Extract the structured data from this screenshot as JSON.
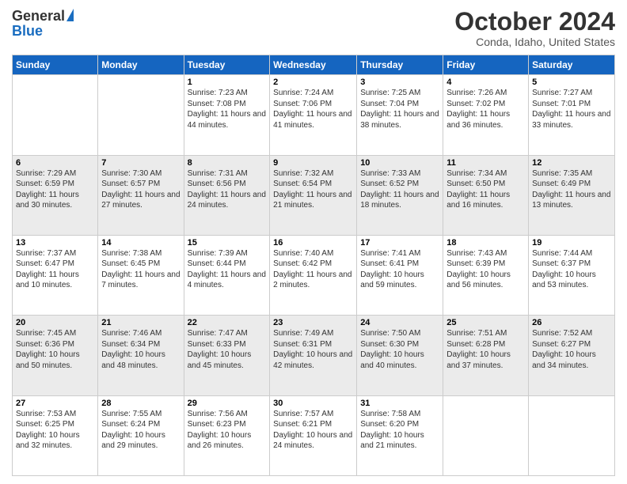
{
  "header": {
    "logo_line1": "General",
    "logo_line2": "Blue",
    "month_title": "October 2024",
    "location": "Conda, Idaho, United States"
  },
  "days_of_week": [
    "Sunday",
    "Monday",
    "Tuesday",
    "Wednesday",
    "Thursday",
    "Friday",
    "Saturday"
  ],
  "weeks": [
    [
      {
        "day": "",
        "sunrise": "",
        "sunset": "",
        "daylight": ""
      },
      {
        "day": "",
        "sunrise": "",
        "sunset": "",
        "daylight": ""
      },
      {
        "day": "1",
        "sunrise": "Sunrise: 7:23 AM",
        "sunset": "Sunset: 7:08 PM",
        "daylight": "Daylight: 11 hours and 44 minutes."
      },
      {
        "day": "2",
        "sunrise": "Sunrise: 7:24 AM",
        "sunset": "Sunset: 7:06 PM",
        "daylight": "Daylight: 11 hours and 41 minutes."
      },
      {
        "day": "3",
        "sunrise": "Sunrise: 7:25 AM",
        "sunset": "Sunset: 7:04 PM",
        "daylight": "Daylight: 11 hours and 38 minutes."
      },
      {
        "day": "4",
        "sunrise": "Sunrise: 7:26 AM",
        "sunset": "Sunset: 7:02 PM",
        "daylight": "Daylight: 11 hours and 36 minutes."
      },
      {
        "day": "5",
        "sunrise": "Sunrise: 7:27 AM",
        "sunset": "Sunset: 7:01 PM",
        "daylight": "Daylight: 11 hours and 33 minutes."
      }
    ],
    [
      {
        "day": "6",
        "sunrise": "Sunrise: 7:29 AM",
        "sunset": "Sunset: 6:59 PM",
        "daylight": "Daylight: 11 hours and 30 minutes."
      },
      {
        "day": "7",
        "sunrise": "Sunrise: 7:30 AM",
        "sunset": "Sunset: 6:57 PM",
        "daylight": "Daylight: 11 hours and 27 minutes."
      },
      {
        "day": "8",
        "sunrise": "Sunrise: 7:31 AM",
        "sunset": "Sunset: 6:56 PM",
        "daylight": "Daylight: 11 hours and 24 minutes."
      },
      {
        "day": "9",
        "sunrise": "Sunrise: 7:32 AM",
        "sunset": "Sunset: 6:54 PM",
        "daylight": "Daylight: 11 hours and 21 minutes."
      },
      {
        "day": "10",
        "sunrise": "Sunrise: 7:33 AM",
        "sunset": "Sunset: 6:52 PM",
        "daylight": "Daylight: 11 hours and 18 minutes."
      },
      {
        "day": "11",
        "sunrise": "Sunrise: 7:34 AM",
        "sunset": "Sunset: 6:50 PM",
        "daylight": "Daylight: 11 hours and 16 minutes."
      },
      {
        "day": "12",
        "sunrise": "Sunrise: 7:35 AM",
        "sunset": "Sunset: 6:49 PM",
        "daylight": "Daylight: 11 hours and 13 minutes."
      }
    ],
    [
      {
        "day": "13",
        "sunrise": "Sunrise: 7:37 AM",
        "sunset": "Sunset: 6:47 PM",
        "daylight": "Daylight: 11 hours and 10 minutes."
      },
      {
        "day": "14",
        "sunrise": "Sunrise: 7:38 AM",
        "sunset": "Sunset: 6:45 PM",
        "daylight": "Daylight: 11 hours and 7 minutes."
      },
      {
        "day": "15",
        "sunrise": "Sunrise: 7:39 AM",
        "sunset": "Sunset: 6:44 PM",
        "daylight": "Daylight: 11 hours and 4 minutes."
      },
      {
        "day": "16",
        "sunrise": "Sunrise: 7:40 AM",
        "sunset": "Sunset: 6:42 PM",
        "daylight": "Daylight: 11 hours and 2 minutes."
      },
      {
        "day": "17",
        "sunrise": "Sunrise: 7:41 AM",
        "sunset": "Sunset: 6:41 PM",
        "daylight": "Daylight: 10 hours and 59 minutes."
      },
      {
        "day": "18",
        "sunrise": "Sunrise: 7:43 AM",
        "sunset": "Sunset: 6:39 PM",
        "daylight": "Daylight: 10 hours and 56 minutes."
      },
      {
        "day": "19",
        "sunrise": "Sunrise: 7:44 AM",
        "sunset": "Sunset: 6:37 PM",
        "daylight": "Daylight: 10 hours and 53 minutes."
      }
    ],
    [
      {
        "day": "20",
        "sunrise": "Sunrise: 7:45 AM",
        "sunset": "Sunset: 6:36 PM",
        "daylight": "Daylight: 10 hours and 50 minutes."
      },
      {
        "day": "21",
        "sunrise": "Sunrise: 7:46 AM",
        "sunset": "Sunset: 6:34 PM",
        "daylight": "Daylight: 10 hours and 48 minutes."
      },
      {
        "day": "22",
        "sunrise": "Sunrise: 7:47 AM",
        "sunset": "Sunset: 6:33 PM",
        "daylight": "Daylight: 10 hours and 45 minutes."
      },
      {
        "day": "23",
        "sunrise": "Sunrise: 7:49 AM",
        "sunset": "Sunset: 6:31 PM",
        "daylight": "Daylight: 10 hours and 42 minutes."
      },
      {
        "day": "24",
        "sunrise": "Sunrise: 7:50 AM",
        "sunset": "Sunset: 6:30 PM",
        "daylight": "Daylight: 10 hours and 40 minutes."
      },
      {
        "day": "25",
        "sunrise": "Sunrise: 7:51 AM",
        "sunset": "Sunset: 6:28 PM",
        "daylight": "Daylight: 10 hours and 37 minutes."
      },
      {
        "day": "26",
        "sunrise": "Sunrise: 7:52 AM",
        "sunset": "Sunset: 6:27 PM",
        "daylight": "Daylight: 10 hours and 34 minutes."
      }
    ],
    [
      {
        "day": "27",
        "sunrise": "Sunrise: 7:53 AM",
        "sunset": "Sunset: 6:25 PM",
        "daylight": "Daylight: 10 hours and 32 minutes."
      },
      {
        "day": "28",
        "sunrise": "Sunrise: 7:55 AM",
        "sunset": "Sunset: 6:24 PM",
        "daylight": "Daylight: 10 hours and 29 minutes."
      },
      {
        "day": "29",
        "sunrise": "Sunrise: 7:56 AM",
        "sunset": "Sunset: 6:23 PM",
        "daylight": "Daylight: 10 hours and 26 minutes."
      },
      {
        "day": "30",
        "sunrise": "Sunrise: 7:57 AM",
        "sunset": "Sunset: 6:21 PM",
        "daylight": "Daylight: 10 hours and 24 minutes."
      },
      {
        "day": "31",
        "sunrise": "Sunrise: 7:58 AM",
        "sunset": "Sunset: 6:20 PM",
        "daylight": "Daylight: 10 hours and 21 minutes."
      },
      {
        "day": "",
        "sunrise": "",
        "sunset": "",
        "daylight": ""
      },
      {
        "day": "",
        "sunrise": "",
        "sunset": "",
        "daylight": ""
      }
    ]
  ]
}
